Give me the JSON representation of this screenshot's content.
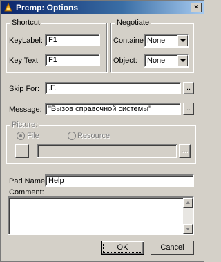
{
  "window": {
    "title": "Prcmp: Options",
    "close_label": "×"
  },
  "shortcut": {
    "group_label": "Shortcut",
    "keylabel_label": "KeyLabel:",
    "keylabel_value": "F1",
    "keytext_label": "Key Text",
    "keytext_value": "F1"
  },
  "negotiate": {
    "group_label": "Negotiate",
    "container_label": "Container",
    "container_value": "None",
    "object_label": "Object:",
    "object_value": "None"
  },
  "skip_for": {
    "label": "Skip For:",
    "value": ".F.",
    "ellipsis": ".."
  },
  "message": {
    "label": "Message:",
    "value": "\"Вызов справочной системы\"",
    "ellipsis": ".."
  },
  "picture": {
    "group_label": "Picture:",
    "file_label": "File",
    "resource_label": "Resource",
    "value": "",
    "ellipsis": "..."
  },
  "pad_name": {
    "label": "Pad Name:",
    "value": "Help"
  },
  "comment": {
    "label": "Comment:",
    "value": ""
  },
  "buttons": {
    "ok": "OK",
    "cancel": "Cancel"
  }
}
